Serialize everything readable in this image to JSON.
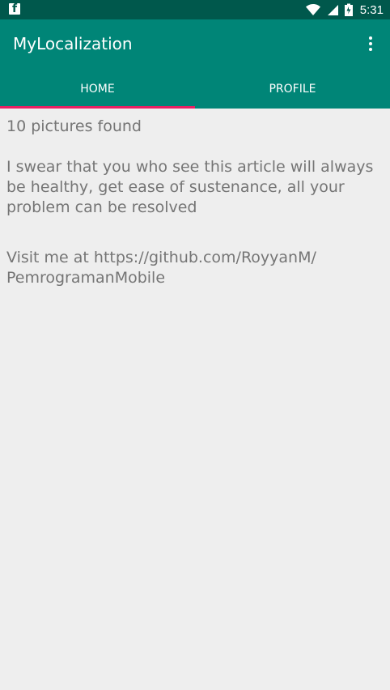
{
  "status_bar": {
    "time": "5:31",
    "facebook_letter": "f",
    "battery_icon": "battery-icon",
    "wifi_icon": "wifi-icon",
    "signal_icon": "signal-icon",
    "colors": {
      "background": "#00584c",
      "foreground": "#ffffff"
    }
  },
  "app_bar": {
    "title": "MyLocalization",
    "overflow_icon": "more-vert-icon",
    "colors": {
      "background": "#008577",
      "indicator": "#e91e63"
    }
  },
  "tabs": [
    {
      "label": "HOME",
      "selected": true
    },
    {
      "label": "PROFILE",
      "selected": false
    }
  ],
  "main": {
    "pictures_found": "10 pictures found",
    "article": "I swear that you who see this article will always be healthy, get ease of sustenance, all your problem can be resolved",
    "visit": "Visit me at https://github.com/RoyyanM/\nPemrogramanMobile"
  }
}
